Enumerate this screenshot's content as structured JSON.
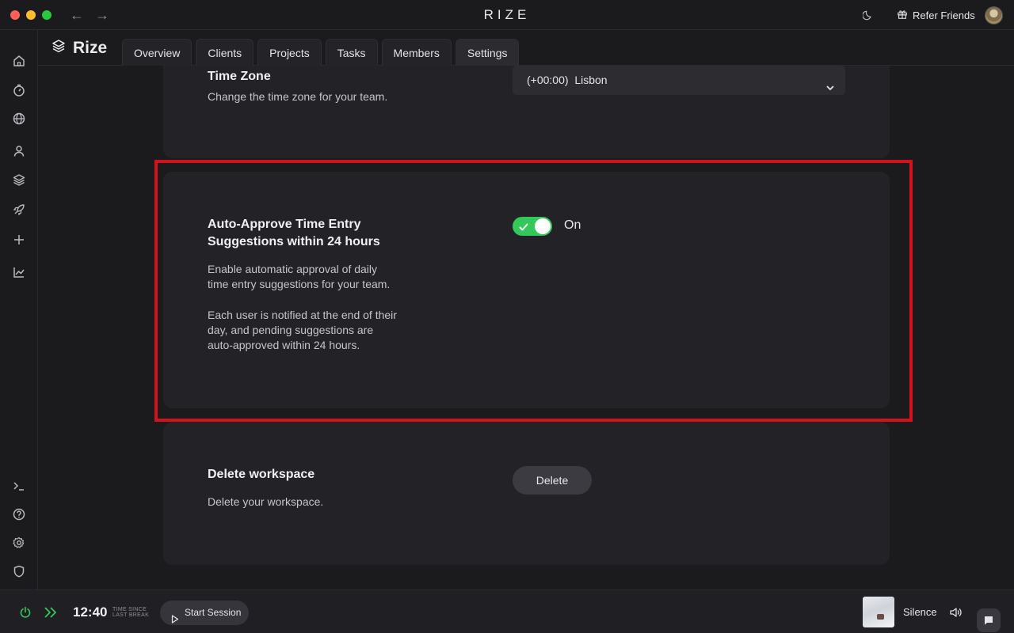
{
  "window": {
    "app_title": "RIZE",
    "back_arrow": "←",
    "forward_arrow": "→",
    "refer_label": "Refer Friends"
  },
  "rail": {
    "top_icons": [
      "home-icon",
      "timer-icon",
      "globe-icon",
      "user-icon",
      "layers-icon",
      "rocket-icon",
      "plus-icon",
      "chart-icon"
    ],
    "bottom_icons": [
      "terminal-icon",
      "help-icon",
      "gear-icon",
      "shield-icon"
    ]
  },
  "header": {
    "brand": "Rize",
    "tabs": [
      {
        "label": "Overview",
        "active": false
      },
      {
        "label": "Clients",
        "active": false
      },
      {
        "label": "Projects",
        "active": false
      },
      {
        "label": "Tasks",
        "active": false
      },
      {
        "label": "Members",
        "active": false
      },
      {
        "label": "Settings",
        "active": true
      }
    ]
  },
  "settings": {
    "timezone": {
      "title": "Time Zone",
      "description": "Change the time zone for your team.",
      "value": "(+00:00)  Lisbon"
    },
    "auto_approve": {
      "title": "Auto-Approve Time Entry Suggestions within 24 hours",
      "description_1": "Enable automatic approval of daily time entry suggestions for your team.",
      "description_2": "Each user is notified at the end of their day, and pending suggestions are auto-approved within 24 hours.",
      "toggle_state": "On",
      "enabled": true
    },
    "delete_workspace": {
      "title": "Delete workspace",
      "description": "Delete your workspace.",
      "button_label": "Delete"
    }
  },
  "bottom_bar": {
    "timer": "12:40",
    "timer_caption_line1": "TIME SINCE",
    "timer_caption_line2": "LAST BREAK",
    "start_session_label": "Start Session",
    "music_title": "Silence"
  },
  "colors": {
    "accent_green": "#34c759",
    "highlight_red": "#d3121b",
    "background": "#1b1b1e",
    "card": "#232327"
  }
}
